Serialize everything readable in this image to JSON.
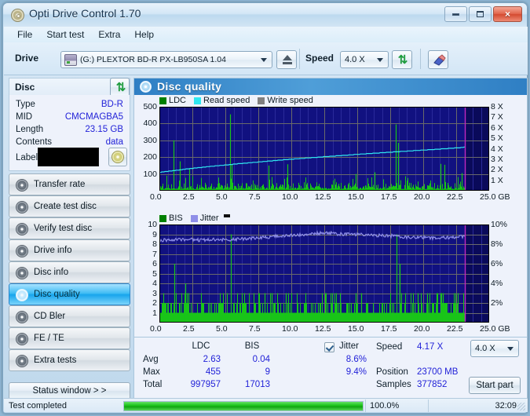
{
  "window": {
    "title": "Opti Drive Control 1.70",
    "icon": "disc-icon",
    "buttons": {
      "minimize": "minimize-icon",
      "maximize": "maximize-icon",
      "close": "×"
    }
  },
  "menu": {
    "items": [
      "File",
      "Start test",
      "Extra",
      "Help"
    ]
  },
  "toolbar": {
    "drive_label": "Drive",
    "drive_value": "(G:)   PLEXTOR BD-R  PX-LB950SA 1.04",
    "eject_icon": "eject-icon",
    "speed_label": "Speed",
    "speed_value": "4.0 X",
    "refresh_icon": "refresh-icon",
    "erase_icon": "erase-icon"
  },
  "disc": {
    "header": "Disc",
    "refresh_icon": "refresh-icon",
    "fields": [
      {
        "key": "Type",
        "value": "BD-R"
      },
      {
        "key": "MID",
        "value": "CMCMAGBA5"
      },
      {
        "key": "Length",
        "value": "23.15 GB"
      },
      {
        "key": "Contents",
        "value": "data"
      }
    ],
    "label_key": "Label",
    "label_value": "",
    "label_button_icon": "disc-icon"
  },
  "nav": {
    "items": [
      {
        "label": "Transfer rate",
        "icon": "disc-icon",
        "active": false
      },
      {
        "label": "Create test disc",
        "icon": "disc-icon",
        "active": false
      },
      {
        "label": "Verify test disc",
        "icon": "disc-icon",
        "active": false
      },
      {
        "label": "Drive info",
        "icon": "disc-icon",
        "active": false
      },
      {
        "label": "Disc info",
        "icon": "disc-icon",
        "active": false
      },
      {
        "label": "Disc quality",
        "icon": "disc-icon",
        "active": true
      },
      {
        "label": "CD Bler",
        "icon": "disc-icon",
        "active": false
      },
      {
        "label": "FE / TE",
        "icon": "disc-icon",
        "active": false
      },
      {
        "label": "Extra tests",
        "icon": "disc-icon",
        "active": false
      }
    ],
    "status_window_button": "Status window > >"
  },
  "panel": {
    "title": "Disc quality",
    "icon": "disc-icon"
  },
  "stats": {
    "row_labels": [
      "Avg",
      "Max",
      "Total"
    ],
    "columns": [
      "LDC",
      "BIS"
    ],
    "ldc": {
      "avg": "2.63",
      "max": "455",
      "total": "997957"
    },
    "bis": {
      "avg": "0.04",
      "max": "9",
      "total": "17013"
    },
    "jitter": {
      "label": "Jitter",
      "checked": true,
      "avg": "8.6%",
      "max": "9.4%"
    },
    "speed_label": "Speed",
    "speed_value": "4.17 X",
    "speed_select": "4.0 X",
    "position_label": "Position",
    "position_value": "23700 MB",
    "samples_label": "Samples",
    "samples_value": "377852",
    "start_part_button": "Start part"
  },
  "statusbar": {
    "message": "Test completed",
    "percent": "100.0%",
    "progress": 100,
    "elapsed": "32:09"
  },
  "colors": {
    "ldc_green": "#19c419",
    "read_speed_cyan": "#30e8f0",
    "write_speed_gray": "#808080",
    "bis_green": "#19c419",
    "jitter_blue": "#8f8fe8",
    "plot_bg": "#0a0a5a",
    "marker_magenta": "#c028c0",
    "value_blue": "#2222d8",
    "accent_header": "#2f7fc4"
  },
  "chart_data": [
    {
      "type": "line",
      "id": "top-chart",
      "title": "",
      "legend": [
        {
          "name": "LDC",
          "color": "#008000"
        },
        {
          "name": "Read speed",
          "color": "#30e8f0"
        },
        {
          "name": "Write speed",
          "color": "#808080"
        }
      ],
      "legend_position": "top-left",
      "grid": true,
      "xlabel": "GB",
      "xlim": [
        0,
        25
      ],
      "xticks": [
        "0.0",
        "2.5",
        "5.0",
        "7.5",
        "10.0",
        "12.5",
        "15.0",
        "17.5",
        "20.0",
        "22.5",
        "25.0"
      ],
      "ylabel": "LDC",
      "ylim": [
        0,
        500
      ],
      "yticks": [
        "100",
        "200",
        "300",
        "400",
        "500"
      ],
      "y2label": "Speed",
      "y2lim": [
        0,
        8
      ],
      "y2ticks": [
        "1 X",
        "2 X",
        "3 X",
        "4 X",
        "5 X",
        "6 X",
        "7 X",
        "8 X"
      ],
      "data_end_gb": 23.15,
      "marker_gb": 23.15,
      "series": [
        {
          "name": "Read speed",
          "color": "#30e8f0",
          "axis": "right",
          "x": [
            0.0,
            1.0,
            2.0,
            3.0,
            4.0,
            5.0,
            6.0,
            7.0,
            8.0,
            9.0,
            10.0,
            11.0,
            12.0,
            13.0,
            14.0,
            15.0,
            16.0,
            17.0,
            18.0,
            19.0,
            20.0,
            21.0,
            22.0,
            23.0,
            23.15
          ],
          "y": [
            1.75,
            1.9,
            2.06,
            2.2,
            2.33,
            2.45,
            2.57,
            2.68,
            2.79,
            2.9,
            3.0,
            3.1,
            3.19,
            3.28,
            3.37,
            3.46,
            3.55,
            3.63,
            3.71,
            3.79,
            3.87,
            3.95,
            4.03,
            4.12,
            4.17
          ]
        },
        {
          "name": "LDC",
          "color": "#19c419",
          "axis": "left",
          "note": "dense spike histogram along disc length; baseline ~15-40, notable spikes listed",
          "spikes": [
            {
              "x": 1.05,
              "y": 300
            },
            {
              "x": 1.55,
              "y": 175
            },
            {
              "x": 2.25,
              "y": 130
            },
            {
              "x": 5.35,
              "y": 455
            },
            {
              "x": 5.45,
              "y": 155
            },
            {
              "x": 8.3,
              "y": 150
            },
            {
              "x": 9.7,
              "y": 158
            },
            {
              "x": 14.9,
              "y": 100
            },
            {
              "x": 16.3,
              "y": 110
            },
            {
              "x": 17.9,
              "y": 395
            },
            {
              "x": 18.1,
              "y": 285
            },
            {
              "x": 21.3,
              "y": 160
            },
            {
              "x": 21.6,
              "y": 155
            },
            {
              "x": 22.9,
              "y": 105
            }
          ]
        }
      ]
    },
    {
      "type": "line",
      "id": "bottom-chart",
      "title": "",
      "legend": [
        {
          "name": "BIS",
          "color": "#008000"
        },
        {
          "name": "Jitter",
          "color": "#8f8fe8"
        }
      ],
      "legend_position": "top-left",
      "grid": true,
      "xlabel": "GB",
      "xlim": [
        0,
        25
      ],
      "xticks": [
        "0.0",
        "2.5",
        "5.0",
        "7.5",
        "10.0",
        "12.5",
        "15.0",
        "17.5",
        "20.0",
        "22.5",
        "25.0"
      ],
      "ylabel": "BIS",
      "ylim": [
        0,
        10
      ],
      "yticks": [
        "1",
        "2",
        "3",
        "4",
        "5",
        "6",
        "7",
        "8",
        "9",
        "10"
      ],
      "y2label": "Jitter",
      "y2lim": [
        0,
        10
      ],
      "y2ticks": [
        "2%",
        "4%",
        "6%",
        "8%",
        "10%"
      ],
      "data_end_gb": 23.15,
      "marker_gb": 23.15,
      "series": [
        {
          "name": "Jitter",
          "color": "#8f8fe8",
          "axis": "right",
          "x": [
            0.0,
            1.0,
            2.0,
            3.0,
            4.0,
            5.0,
            6.0,
            7.0,
            8.0,
            9.0,
            10.0,
            11.0,
            12.0,
            13.0,
            14.0,
            15.0,
            16.0,
            17.0,
            18.0,
            19.0,
            20.0,
            21.0,
            22.0,
            23.0,
            23.15
          ],
          "y": [
            8.4,
            8.4,
            8.5,
            8.4,
            8.5,
            8.4,
            8.5,
            8.6,
            8.7,
            8.8,
            8.9,
            9.0,
            9.1,
            9.1,
            9.0,
            9.0,
            8.9,
            8.9,
            8.8,
            8.7,
            8.7,
            8.6,
            8.7,
            8.8,
            8.7
          ]
        },
        {
          "name": "BIS",
          "color": "#19c419",
          "axis": "left",
          "note": "dense bar histogram, baseline 1, frequent 2-3, occasional higher",
          "spikes": [
            {
              "x": 1.15,
              "y": 6
            },
            {
              "x": 1.95,
              "y": 4
            },
            {
              "x": 5.4,
              "y": 9
            },
            {
              "x": 8.0,
              "y": 3
            },
            {
              "x": 8.5,
              "y": 3
            },
            {
              "x": 9.6,
              "y": 3
            },
            {
              "x": 14.9,
              "y": 3
            },
            {
              "x": 15.3,
              "y": 3
            },
            {
              "x": 18.0,
              "y": 9
            },
            {
              "x": 18.2,
              "y": 6
            },
            {
              "x": 19.6,
              "y": 3
            },
            {
              "x": 20.3,
              "y": 3
            },
            {
              "x": 21.0,
              "y": 3
            },
            {
              "x": 21.5,
              "y": 3
            }
          ]
        }
      ]
    }
  ]
}
